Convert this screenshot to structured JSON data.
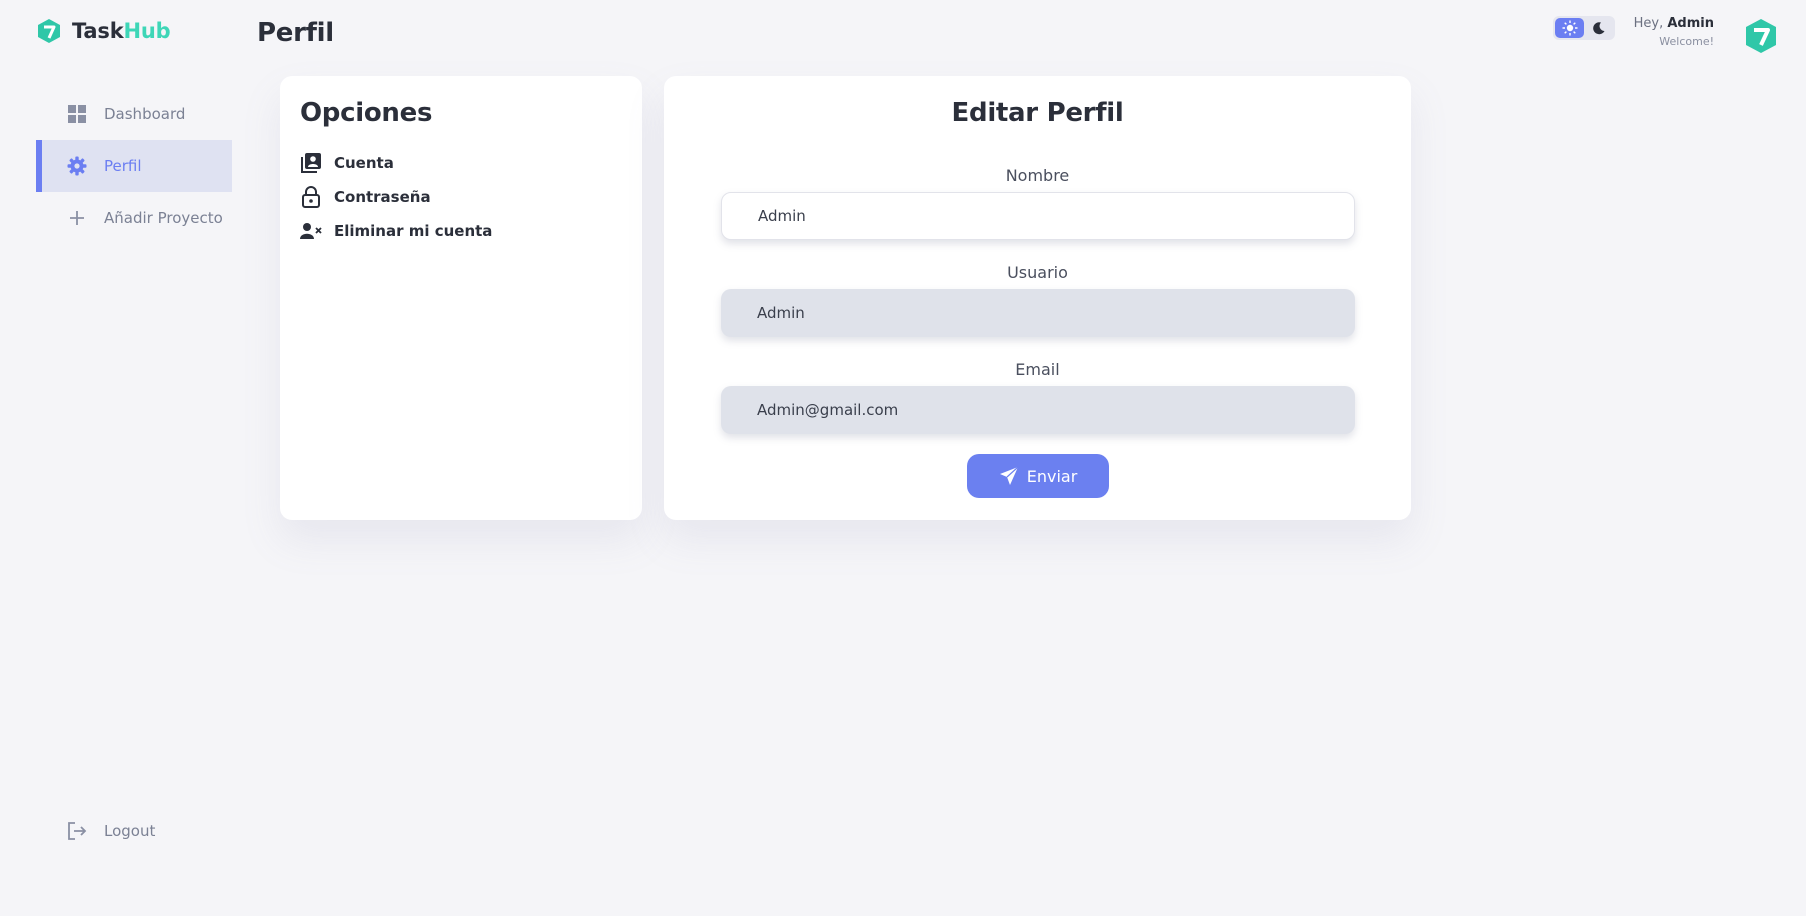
{
  "brand": {
    "name_part1": "Task",
    "name_part2": "Hub",
    "accent_color": "#3ed6b7"
  },
  "sidebar": {
    "items": [
      {
        "label": "Dashboard",
        "icon": "grid-icon",
        "active": false
      },
      {
        "label": "Perfil",
        "icon": "gear-icon",
        "active": true
      },
      {
        "label": "Añadir Proyecto",
        "icon": "plus-icon",
        "active": false
      }
    ],
    "logout_label": "Logout"
  },
  "header": {
    "title": "Perfil",
    "theme": {
      "light_icon": "sun-icon",
      "dark_icon": "moon-icon",
      "selected": "light"
    },
    "greeting_prefix": "Hey,",
    "user_name": "Admin",
    "welcome": "Welcome!"
  },
  "options": {
    "title": "Opciones",
    "items": [
      {
        "label": "Cuenta",
        "icon": "account-box-icon"
      },
      {
        "label": "Contraseña",
        "icon": "lock-icon"
      },
      {
        "label": "Eliminar mi cuenta",
        "icon": "user-remove-icon"
      }
    ]
  },
  "edit_profile": {
    "title": "Editar Perfil",
    "fields": [
      {
        "label": "Nombre",
        "value": "Admin",
        "editable": true
      },
      {
        "label": "Usuario",
        "value": "Admin",
        "editable": false
      },
      {
        "label": "Email",
        "value": "Admin@gmail.com",
        "editable": false
      }
    ],
    "submit_label": "Enviar",
    "submit_icon": "send-icon"
  },
  "colors": {
    "primary": "#6b7ef2",
    "background": "#f5f5f8",
    "text": "#2b2f3a"
  }
}
